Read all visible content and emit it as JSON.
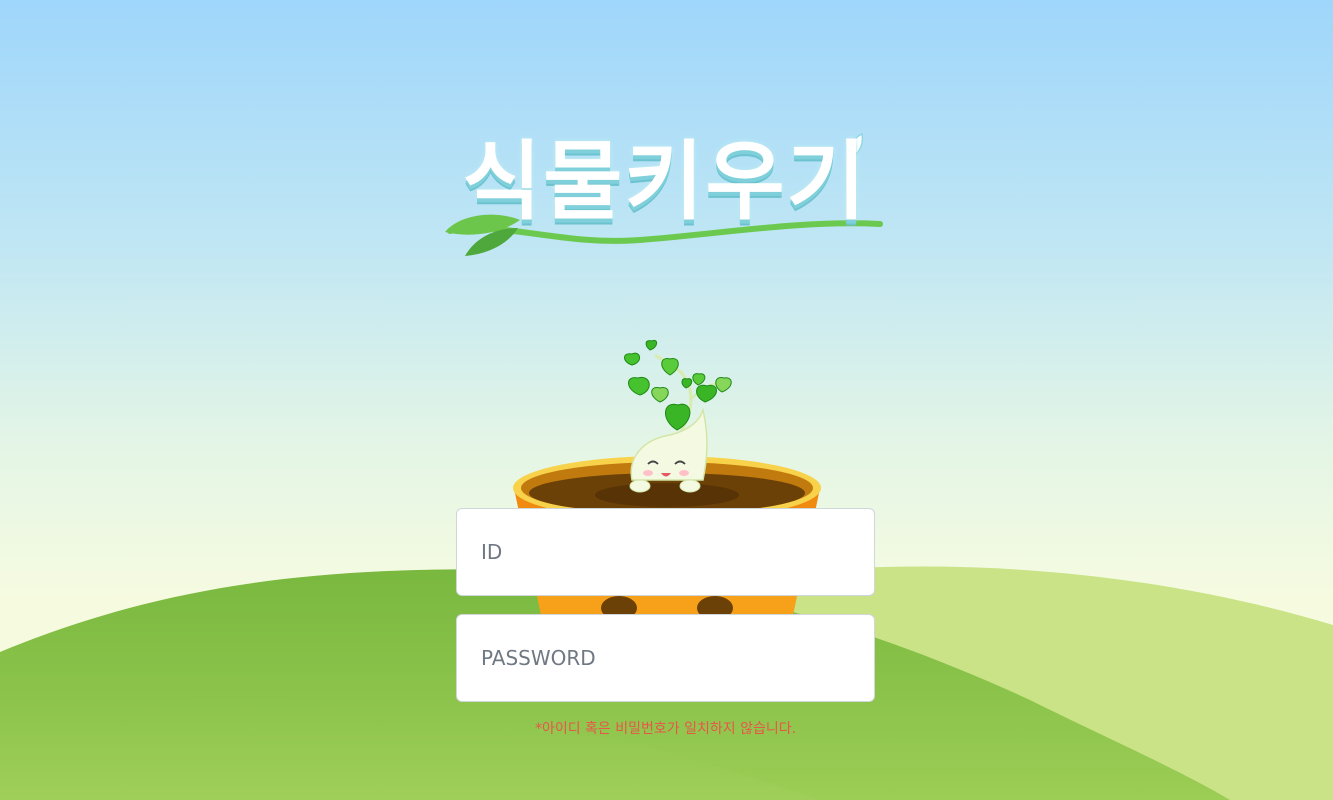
{
  "logo": {
    "title": "식물키우기"
  },
  "login": {
    "id_placeholder": "ID",
    "password_placeholder": "PASSWORD",
    "error_message": "*아이디 혹은 비밀번호가 일치하지 않습니다."
  },
  "colors": {
    "sky_top": "#9fd6fb",
    "hill_dark": "#7dbd45",
    "hill_light": "#c9e386",
    "error": "#e8564a",
    "pot_orange": "#f7a11a"
  }
}
